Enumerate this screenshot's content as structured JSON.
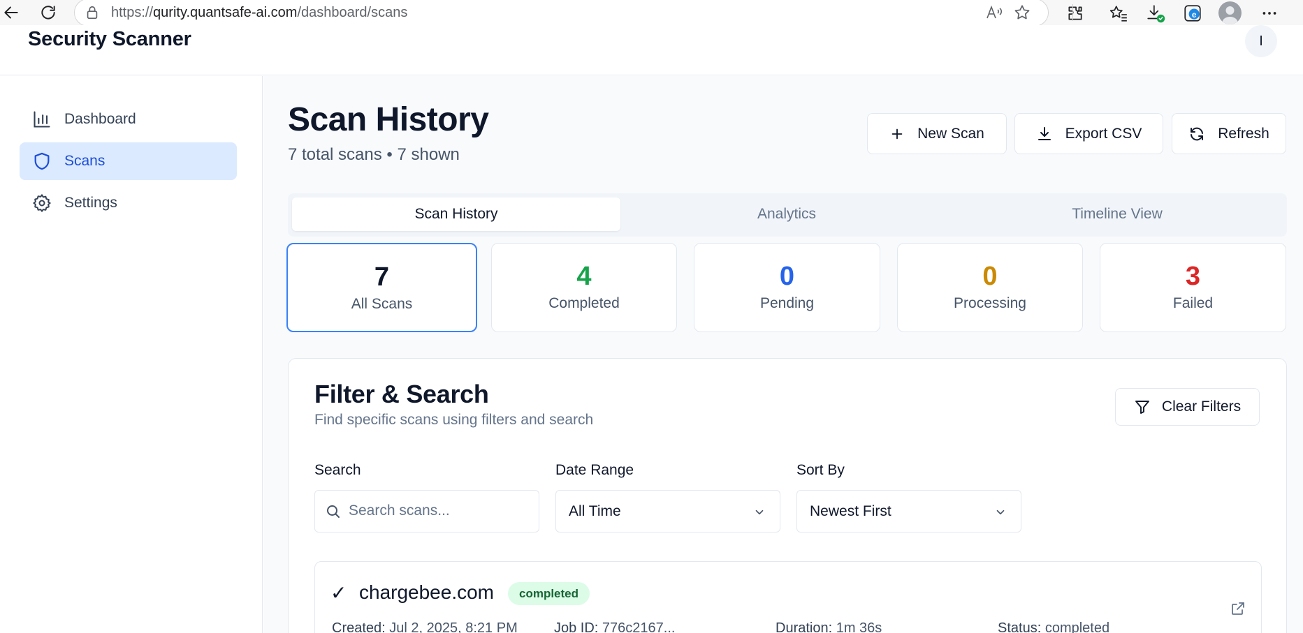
{
  "browser": {
    "url_prefix": "https://",
    "url_host": "qurity.quantsafe-ai.com",
    "url_path": "/dashboard/scans"
  },
  "app": {
    "title": "Security Scanner",
    "user_initial": "I"
  },
  "sidebar": {
    "items": [
      {
        "label": "Dashboard",
        "icon": "bar-chart-icon",
        "active": false
      },
      {
        "label": "Scans",
        "icon": "shield-icon",
        "active": true
      },
      {
        "label": "Settings",
        "icon": "gear-icon",
        "active": false
      }
    ]
  },
  "page": {
    "title": "Scan History",
    "subtitle": "7 total scans • 7 shown"
  },
  "actions": {
    "new_scan": "New Scan",
    "export_csv": "Export CSV",
    "refresh": "Refresh"
  },
  "tabs": [
    {
      "label": "Scan History",
      "active": true
    },
    {
      "label": "Analytics",
      "active": false
    },
    {
      "label": "Timeline View",
      "active": false
    }
  ],
  "stats": [
    {
      "value": "7",
      "label": "All Scans",
      "color": "#0f172a",
      "active": true
    },
    {
      "value": "4",
      "label": "Completed",
      "color": "#16a34a",
      "active": false
    },
    {
      "value": "0",
      "label": "Pending",
      "color": "#2563eb",
      "active": false
    },
    {
      "value": "0",
      "label": "Processing",
      "color": "#ca8a04",
      "active": false
    },
    {
      "value": "3",
      "label": "Failed",
      "color": "#dc2626",
      "active": false
    }
  ],
  "filters": {
    "title": "Filter & Search",
    "subtitle": "Find specific scans using filters and search",
    "clear_label": "Clear Filters",
    "search_label": "Search",
    "search_placeholder": "Search scans...",
    "search_value": "",
    "date_label": "Date Range",
    "date_value": "All Time",
    "sort_label": "Sort By",
    "sort_value": "Newest First"
  },
  "scans": [
    {
      "check": "✓",
      "domain": "chargebee.com",
      "badge": "completed",
      "created_label": "Created:",
      "created_value": "Jul 2, 2025, 8:21 PM",
      "job_label": "Job ID:",
      "job_value": "776c2167...",
      "duration_label": "Duration:",
      "duration_value": "1m 36s",
      "status_label": "Status:",
      "status_value": "completed"
    }
  ]
}
